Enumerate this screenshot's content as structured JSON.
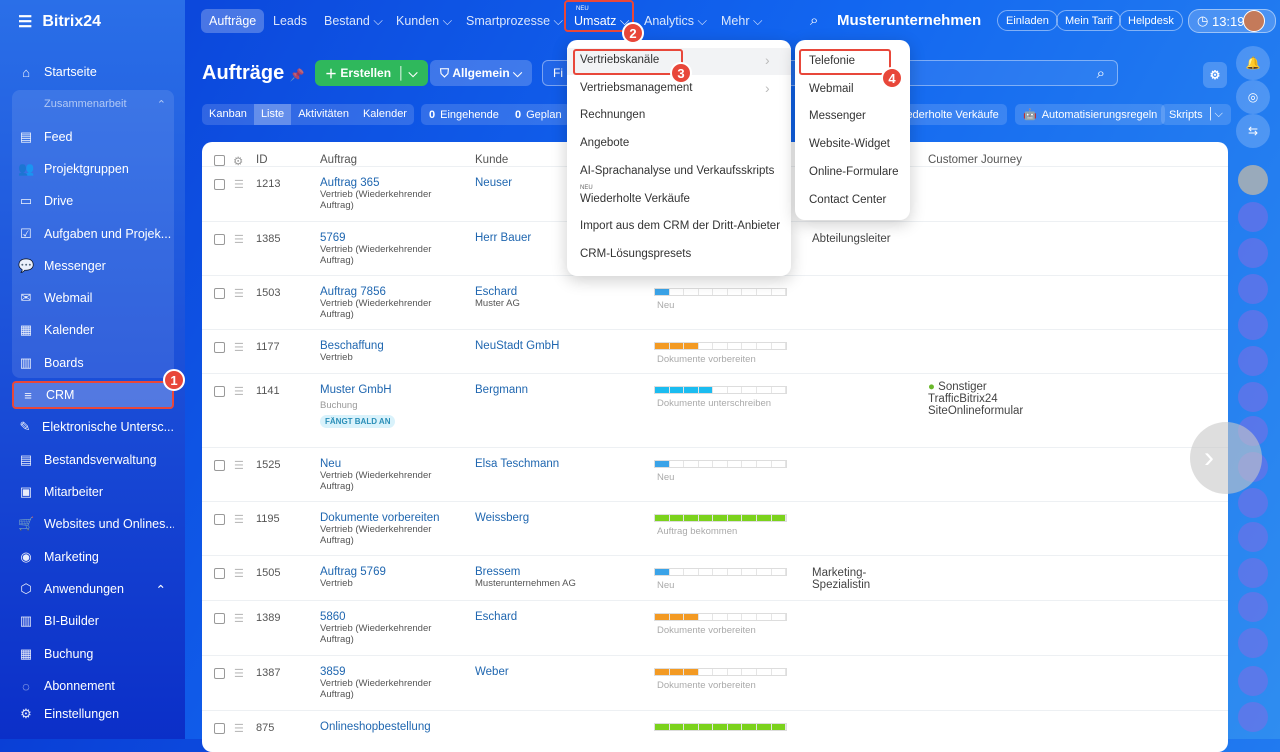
{
  "app": {
    "logo": "Bitrix24",
    "company": "Musterunternehmen",
    "time": "13:19"
  },
  "topnav": [
    {
      "label": "Aufträge"
    },
    {
      "label": "Leads"
    },
    {
      "label": "Bestand ⌵"
    },
    {
      "label": "Kunden ⌵"
    },
    {
      "label": "Smartprozesse ⌵"
    },
    {
      "label": "Umsatz ⌵",
      "tag": "NEU"
    },
    {
      "label": "Analytics ⌵"
    },
    {
      "label": "Mehr ⌵"
    }
  ],
  "top_buttons": [
    "Einladen",
    "Mein Tarif",
    "Helpdesk"
  ],
  "sidebar": {
    "items": [
      "Startseite",
      "Zusammenarbeit",
      "Feed",
      "Projektgruppen",
      "Drive",
      "Aufgaben und Projek...",
      "Messenger",
      "Webmail",
      "Kalender",
      "Boards",
      "CRM",
      "Elektronische Untersc...",
      "Bestandsverwaltung",
      "Mitarbeiter",
      "Websites und Onlines...",
      "Marketing",
      "Anwendungen",
      "BI-Builder",
      "Buchung",
      "Abonnement"
    ],
    "settings": "Einstellungen"
  },
  "page": {
    "title": "Aufträge",
    "create": "Erstellen",
    "filter": "Allgemein",
    "filter_placeholder": "Fi"
  },
  "view_tabs": [
    "Kanban",
    "Liste",
    "Aktivitäten",
    "Kalender"
  ],
  "counters": [
    {
      "n": "0",
      "label": "Eingehende"
    },
    {
      "n": "0",
      "label": "Geplan"
    }
  ],
  "right_buttons": {
    "repeat": "iederholte Verkäufe",
    "automation": "Automatisierungsregeln",
    "scripts": "Skripts"
  },
  "table": {
    "headers": [
      "ID",
      "Auftrag",
      "Kunde",
      "Customer Journey"
    ],
    "rows": [
      {
        "id": "1213",
        "title": "Auftrag 365",
        "sub": "Vertrieb (Wiederkehrender Auftrag)",
        "client": "Neuser",
        "client_sub": "",
        "stage": "",
        "filled": 0,
        "color": "",
        "extra": "",
        "journey": ""
      },
      {
        "id": "1385",
        "title": "5769",
        "sub": "Vertrieb (Wiederkehrender Auftrag)",
        "client": "Herr Bauer",
        "client_sub": "",
        "stage": "",
        "filled": 0,
        "color": "",
        "extra": "Abteilungsleiter",
        "journey": ""
      },
      {
        "id": "1503",
        "title": "Auftrag 7856",
        "sub": "Vertrieb (Wiederkehrender Auftrag)",
        "client": "Eschard",
        "client_sub": "Muster AG",
        "stage": "Neu",
        "filled": 1,
        "color": "#3aa3e8",
        "extra": "",
        "journey": ""
      },
      {
        "id": "1177",
        "title": "Beschaffung",
        "sub": "Vertrieb",
        "client": "NeuStadt GmbH",
        "client_sub": "",
        "stage": "Dokumente vorbereiten",
        "filled": 3,
        "color": "#f39a23",
        "extra": "",
        "journey": ""
      },
      {
        "id": "1141",
        "title": "Muster GmbH",
        "sub": "Buchung",
        "badge": "FÄNGT BALD AN",
        "client": "Bergmann",
        "client_sub": "",
        "stage": "Dokumente unterschreiben",
        "filled": 4,
        "color": "#1bbcf0",
        "extra": "",
        "journey": "Sonstiger TrafficBitrix24 SiteOnlineformular"
      },
      {
        "id": "1525",
        "title": "Neu",
        "sub": "Vertrieb (Wiederkehrender Auftrag)",
        "client": "Elsa Teschmann",
        "client_sub": "",
        "stage": "Neu",
        "filled": 1,
        "color": "#3aa3e8",
        "extra": "",
        "journey": ""
      },
      {
        "id": "1195",
        "title": "Dokumente vorbereiten",
        "sub": "Vertrieb (Wiederkehrender Auftrag)",
        "client": "Weissberg",
        "client_sub": "",
        "stage": "Auftrag bekommen",
        "filled": 9,
        "color": "#7bd21c",
        "extra": "",
        "journey": ""
      },
      {
        "id": "1505",
        "title": "Auftrag 5769",
        "sub": "Vertrieb",
        "client": "Bressem",
        "client_sub": "Musterunternehmen AG",
        "stage": "Neu",
        "filled": 1,
        "color": "#3aa3e8",
        "extra": "Marketing-Spezialistin",
        "journey": ""
      },
      {
        "id": "1389",
        "title": "5860",
        "sub": "Vertrieb (Wiederkehrender Auftrag)",
        "client": "Eschard",
        "client_sub": "",
        "stage": "Dokumente vorbereiten",
        "filled": 3,
        "color": "#f39a23",
        "extra": "",
        "journey": ""
      },
      {
        "id": "1387",
        "title": "3859",
        "sub": "Vertrieb (Wiederkehrender Auftrag)",
        "client": "Weber",
        "client_sub": "",
        "stage": "Dokumente vorbereiten",
        "filled": 3,
        "color": "#f39a23",
        "extra": "",
        "journey": ""
      },
      {
        "id": "875",
        "title": "Onlineshopbestellung",
        "sub": "",
        "client": "",
        "client_sub": "",
        "stage": "",
        "filled": 9,
        "color": "#7bd21c",
        "extra": "",
        "journey": ""
      }
    ]
  },
  "umsatz_menu": {
    "items": [
      "Vertriebskanäle",
      "Vertriebsmanagement",
      "Rechnungen",
      "Angebote",
      "AI-Sprachanalyse und Verkaufsskripts",
      "Wiederholte Verkäufe",
      "Import aus dem CRM der Dritt-Anbieter",
      "CRM-Lösungspresets"
    ],
    "new_tag": "NEU"
  },
  "channels_menu": {
    "items": [
      "Telefonie",
      "Webmail",
      "Messenger",
      "Website-Widget",
      "Online-Formulare",
      "Contact Center"
    ]
  },
  "steps": [
    "1",
    "2",
    "3",
    "4"
  ]
}
